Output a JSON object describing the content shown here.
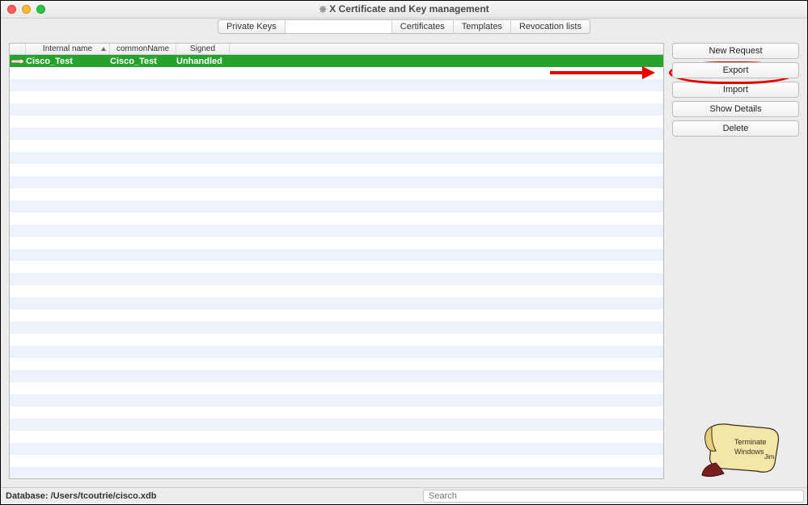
{
  "window": {
    "title": "X Certificate and Key management"
  },
  "tabs": {
    "private_keys": "Private Keys",
    "certificates": "Certificates",
    "templates": "Templates",
    "revocation": "Revocation lists"
  },
  "columns": {
    "internal_name": "Internal name",
    "common_name": "commonName",
    "signed": "Signed"
  },
  "rows": [
    {
      "internal_name": "Cisco_Test",
      "common_name": "Cisco_Test",
      "signed": "Unhandled",
      "selected": true
    }
  ],
  "buttons": {
    "new_request": "New Request",
    "export": "Export",
    "import": "Import",
    "show_details": "Show Details",
    "delete": "Delete"
  },
  "status": {
    "database_label": "Database:",
    "database_path": "/Users/tcoutrie/cisco.xdb",
    "search_placeholder": "Search"
  }
}
